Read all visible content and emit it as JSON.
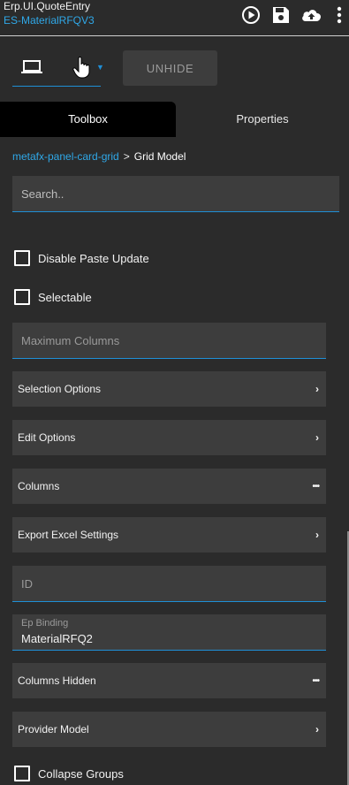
{
  "header": {
    "app_title": "Erp.UI.QuoteEntry",
    "layer_name": "ES-MaterialRFQV3",
    "icons": [
      "play-icon",
      "save-icon",
      "cloud-upload-icon",
      "more-vertical-icon"
    ]
  },
  "toolbar": {
    "device_icon": "laptop-icon",
    "unhide_label": "UNHIDE"
  },
  "tabs": [
    {
      "label": "Toolbox",
      "active": true
    },
    {
      "label": "Properties",
      "active": false
    }
  ],
  "breadcrumb": {
    "parent": "metafx-panel-card-grid",
    "separator": ">",
    "current": "Grid Model"
  },
  "search": {
    "placeholder": "Search..",
    "value": ""
  },
  "properties": {
    "disable_paste_update": {
      "label": "Disable Paste Update",
      "checked": false
    },
    "selectable": {
      "label": "Selectable",
      "checked": false
    },
    "maximum_columns": {
      "placeholder": "Maximum Columns",
      "value": ""
    },
    "selection_options": {
      "label": "Selection Options",
      "icon": "chevron-right-icon"
    },
    "edit_options": {
      "label": "Edit Options",
      "icon": "chevron-right-icon"
    },
    "columns": {
      "label": "Columns",
      "icon": "more-horizontal-icon"
    },
    "export_excel_settings": {
      "label": "Export Excel Settings",
      "icon": "chevron-right-icon"
    },
    "id": {
      "placeholder": "ID",
      "value": ""
    },
    "ep_binding": {
      "label": "Ep Binding",
      "value": "MaterialRFQ2"
    },
    "columns_hidden": {
      "label": "Columns Hidden",
      "icon": "more-horizontal-icon"
    },
    "provider_model": {
      "label": "Provider Model",
      "icon": "chevron-right-icon"
    },
    "collapse_groups": {
      "label": "Collapse Groups",
      "checked": false
    }
  },
  "colors": {
    "background": "#2b2b2b",
    "panel": "#3d3d3d",
    "accent": "#1f8fd6",
    "link": "#2fa8e8",
    "active_tab": "#000000"
  }
}
